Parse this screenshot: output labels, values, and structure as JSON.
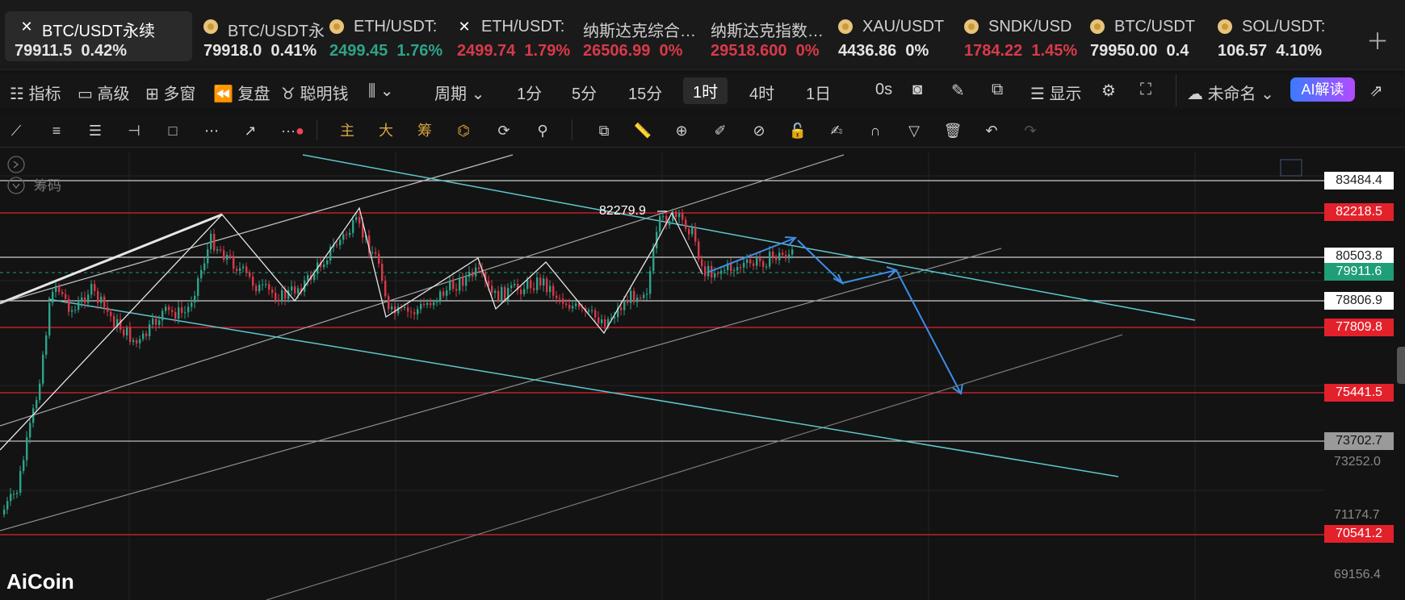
{
  "tabs": [
    {
      "name": "BTC/USDT永续",
      "price": "79911.5",
      "change": "0.42%",
      "dir": "neu",
      "icon": "x-icon"
    },
    {
      "name": "BTC/USDT永",
      "price": "79918.0",
      "change": "0.41%",
      "dir": "neu",
      "icon": "coin-icon"
    },
    {
      "name": "ETH/USDT:",
      "price": "2499.45",
      "change": "1.76%",
      "dir": "up",
      "icon": "coin-icon"
    },
    {
      "name": "ETH/USDT:",
      "price": "2499.74",
      "change": "1.79%",
      "dir": "down",
      "icon": "x-icon"
    },
    {
      "name": "纳斯达克综合…",
      "price": "26506.99",
      "change": "0%",
      "dir": "down",
      "icon": ""
    },
    {
      "name": "纳斯达克指数…",
      "price": "29518.600",
      "change": "0%",
      "dir": "down",
      "icon": ""
    },
    {
      "name": "XAU/USDT",
      "price": "4436.86",
      "change": "0%",
      "dir": "neu",
      "icon": "coin-icon"
    },
    {
      "name": "SNDK/USD",
      "price": "1784.22",
      "change": "1.45%",
      "dir": "down",
      "icon": "coin-icon"
    },
    {
      "name": "BTC/USDT",
      "price": "79950.00",
      "change": "0.4",
      "dir": "neu",
      "icon": "coin-icon"
    },
    {
      "name": "SOL/USDT:",
      "price": "106.57",
      "change": "4.10%",
      "dir": "neu",
      "icon": "coin-icon"
    }
  ],
  "toolbar": {
    "indicator": "指标",
    "advanced": "高级",
    "multi": "多窗",
    "replay": "复盘",
    "smart": "聪明钱",
    "period": "周期",
    "p1": "1分",
    "p5": "5分",
    "p15": "15分",
    "p1h": "1时",
    "p4h": "4时",
    "p1d": "1日",
    "countdown": "0s",
    "display": "显示",
    "unnamed": "未命名",
    "ai": "AI解读"
  },
  "drawtools": {
    "main": "主",
    "big": "大",
    "chip": "筹"
  },
  "chart": {
    "chip_label": "筹码",
    "peak_label": "82279.9",
    "price_labels": [
      {
        "text": "83484.4",
        "style": "white"
      },
      {
        "text": "82218.5",
        "style": "red"
      },
      {
        "text": "80503.8",
        "style": "white"
      },
      {
        "text": "79911.6",
        "style": "green"
      },
      {
        "text": "78806.9",
        "style": "white"
      },
      {
        "text": "77809.8",
        "style": "red"
      },
      {
        "text": "75441.5",
        "style": "red"
      },
      {
        "text": "73702.7",
        "style": "gray"
      },
      {
        "text": "70541.2",
        "style": "red"
      }
    ],
    "axis_labels": [
      "73252.0",
      "71174.7",
      "69156.4"
    ]
  },
  "branding": {
    "logo": "AiCoin"
  }
}
